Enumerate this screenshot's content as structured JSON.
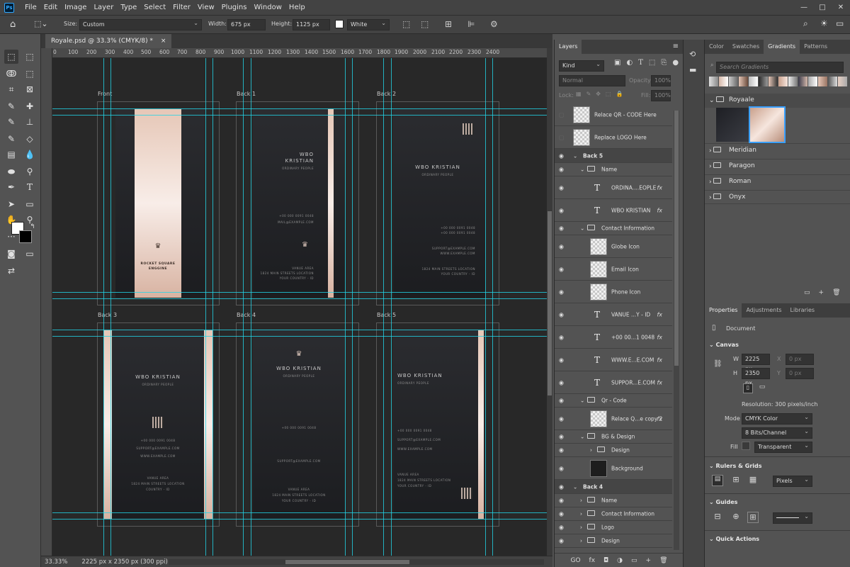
{
  "menubar": {
    "logo": "Ps",
    "items": [
      "File",
      "Edit",
      "Image",
      "Layer",
      "Type",
      "Select",
      "Filter",
      "View",
      "Plugins",
      "Window",
      "Help"
    ],
    "window_buttons": [
      "—",
      "□",
      "✕"
    ]
  },
  "options": {
    "size_label": "Size:",
    "size_value": "Custom",
    "width_label": "Width:",
    "width_value": "675 px",
    "height_label": "Height:",
    "height_value": "1125 px",
    "color_value": "White"
  },
  "document": {
    "tab_title": "Royale.psd @ 33.3% (CMYK/8) *",
    "tab_close": "×",
    "zoom": "33.33%",
    "dimensions": "2225 px x 2350 px (300 ppi)"
  },
  "ruler_ticks": [
    "0",
    "100",
    "200",
    "300",
    "400",
    "500",
    "600",
    "700",
    "800",
    "900",
    "1000",
    "1100",
    "1200",
    "1300",
    "1400",
    "1500",
    "1600",
    "1700",
    "1800",
    "1900",
    "2000",
    "2100",
    "2200",
    "2300",
    "2400"
  ],
  "artboards": {
    "labels": [
      "Front",
      "Back 1",
      "Back 2",
      "Back 3",
      "Back 4",
      "Back 5"
    ],
    "front_company_line1": "ROCKET SQUARE",
    "front_company_line2": "ENGGINE",
    "name": "WBO KRISTIAN",
    "name_line1": "WBO",
    "name_line2": "KRISTIAN",
    "subtitle": "ORDINARY PEOPLE",
    "phone": "+00 000 0091 0048",
    "mail": "MAIL@EXAMPLE.COM",
    "support": "SUPPORT@EXAMPLE.COM",
    "website": "WWW.EXAMPLE.COM",
    "area": "VANUE AREA",
    "street": "1824 MAIN STREETS LOCATION",
    "country": "YOUR COUNTRY - ID",
    "country_short": "COUNTRY - ID"
  },
  "layers_panel": {
    "tab": "Layers",
    "kind": "Kind",
    "blend": "Normal",
    "opacity_label": "Opacity:",
    "opacity_value": "100%",
    "lock_label": "Lock:",
    "fill_label": "Fill:",
    "fill_value": "100%",
    "layers": [
      {
        "name": "Relace QR - CODE Here",
        "type": "smart",
        "indent": 0,
        "eye": false
      },
      {
        "name": "Replace LOGO Here",
        "type": "smart",
        "indent": 0,
        "eye": false
      },
      {
        "name": "Back 5",
        "type": "artboard",
        "indent": 0,
        "eye": true
      },
      {
        "name": "Name",
        "type": "group",
        "indent": 1,
        "eye": true
      },
      {
        "name": "ORDINA....EOPLE",
        "type": "text",
        "indent": 2,
        "eye": true,
        "fx": true
      },
      {
        "name": "WBO KRISTIAN",
        "type": "text",
        "indent": 2,
        "eye": true,
        "fx": true
      },
      {
        "name": "Contact Information",
        "type": "group",
        "indent": 1,
        "eye": true
      },
      {
        "name": "Globe Icon",
        "type": "smart",
        "indent": 2,
        "eye": true
      },
      {
        "name": "Email Icon",
        "type": "smart",
        "indent": 2,
        "eye": true
      },
      {
        "name": "Phone Icon",
        "type": "smart",
        "indent": 2,
        "eye": true
      },
      {
        "name": "VANUE ...Y - ID",
        "type": "text",
        "indent": 2,
        "eye": true,
        "fx": true
      },
      {
        "name": "+00 00...1 0048",
        "type": "text",
        "indent": 2,
        "eye": true,
        "fx": true
      },
      {
        "name": "WWW.E...E.COM",
        "type": "text",
        "indent": 2,
        "eye": true,
        "fx": true
      },
      {
        "name": "SUPPOR...E.COM",
        "type": "text",
        "indent": 2,
        "eye": true,
        "fx": true
      },
      {
        "name": "Qr - Code",
        "type": "group",
        "indent": 1,
        "eye": true
      },
      {
        "name": "Relace Q...e copy 2",
        "type": "smart",
        "indent": 2,
        "eye": true,
        "fx": true
      },
      {
        "name": "BG & Design",
        "type": "group",
        "indent": 1,
        "eye": true
      },
      {
        "name": "Design",
        "type": "group-collapsed",
        "indent": 2,
        "eye": true
      },
      {
        "name": "Background",
        "type": "smart",
        "indent": 2,
        "eye": true
      },
      {
        "name": "Back 4",
        "type": "artboard",
        "indent": 0,
        "eye": true
      },
      {
        "name": "Name",
        "type": "group-collapsed",
        "indent": 1,
        "eye": true
      },
      {
        "name": "Contact Information",
        "type": "group-collapsed",
        "indent": 1,
        "eye": true
      },
      {
        "name": "Logo",
        "type": "group-collapsed",
        "indent": 1,
        "eye": true
      },
      {
        "name": "Design",
        "type": "group-collapsed",
        "indent": 1,
        "eye": true
      }
    ],
    "footer_icons": [
      "GO",
      "fx",
      "◘",
      "◑",
      "▭",
      "+",
      "🗑"
    ]
  },
  "gradients_panel": {
    "tabs": [
      "Color",
      "Swatches",
      "Gradients",
      "Patterns"
    ],
    "active_tab": "Gradients",
    "search_placeholder": "Search Gradients",
    "groups": [
      "Royaale",
      "Meridian",
      "Paragon",
      "Roman",
      "Onyx"
    ]
  },
  "properties_panel": {
    "tabs": [
      "Properties",
      "Adjustments",
      "Libraries"
    ],
    "doc_label": "Document",
    "canvas_title": "Canvas",
    "w_label": "W",
    "w_value": "2225 px",
    "x_label": "X",
    "x_value": "0 px",
    "h_label": "H",
    "h_value": "2350 px",
    "y_label": "Y",
    "y_value": "0 px",
    "resolution": "Resolution: 300 pixels/inch",
    "mode_label": "Mode",
    "mode_value": "CMYK Color",
    "bits_value": "8 Bits/Channel",
    "fill_label": "Fill",
    "fill_value": "Transparent",
    "rulers_title": "Rulers & Grids",
    "units_value": "Pixels",
    "guides_title": "Guides",
    "quick_actions_title": "Quick Actions"
  },
  "colors": {
    "guide": "#22d3e6",
    "rose_gold": "#e6c7b7",
    "card_dark": "#2b2c30"
  }
}
